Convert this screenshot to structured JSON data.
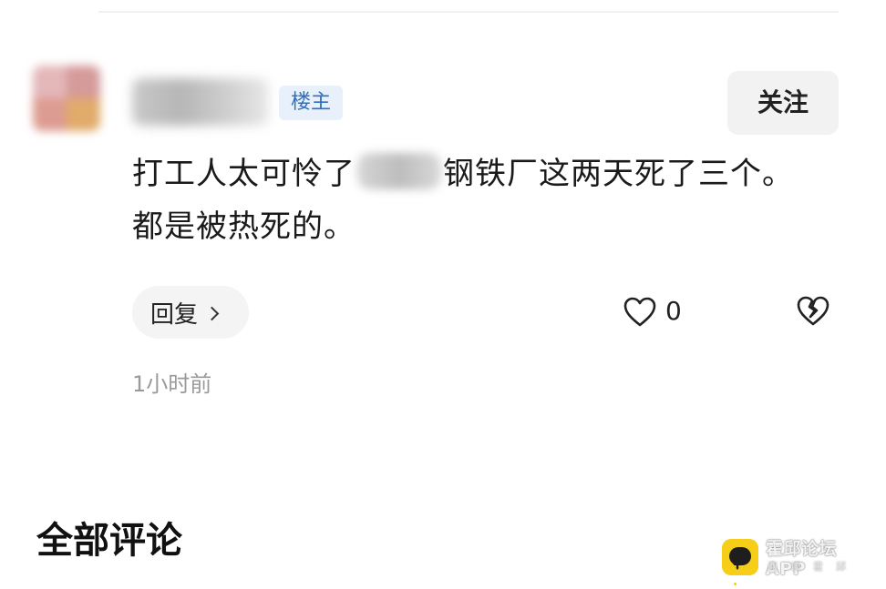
{
  "post": {
    "op_badge": "楼主",
    "follow_label": "关注",
    "text_before": "打工人太可怜了",
    "text_after": "钢铁厂这两天死了三个。都是被热死的。",
    "reply_label": "回复",
    "like_count": "0",
    "timestamp": "1小时前"
  },
  "comments": {
    "section_title": "全部评论"
  },
  "watermark": {
    "app_name": "霍邱论坛APP",
    "slogan": "阅读霍邱"
  },
  "icons": {
    "like": "heart-outline-icon",
    "dislike": "broken-heart-icon",
    "reply_chevron": "chevron-right-icon",
    "watermark": "chat-bubble-icon"
  },
  "colors": {
    "badge_bg": "#e8f1fb",
    "badge_text": "#2f6fbf",
    "button_bg": "#f2f2f3",
    "timestamp": "#9a9a9a",
    "watermark_icon": "#f6cd17"
  }
}
